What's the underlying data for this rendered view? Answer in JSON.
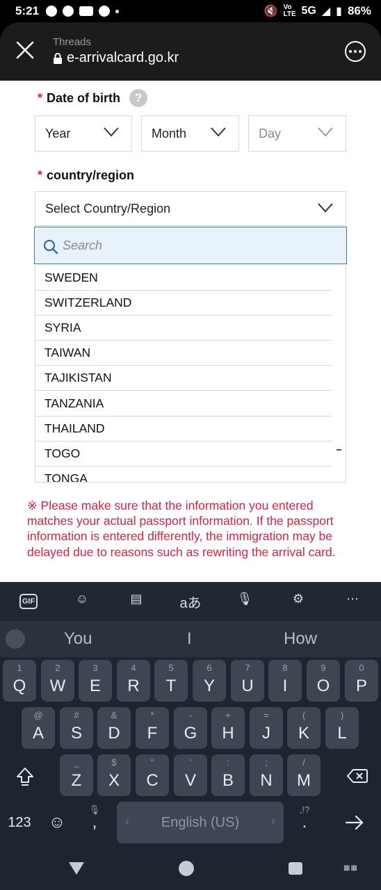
{
  "status_bar": {
    "time": "5:21",
    "network": "5G",
    "battery": "86%",
    "volte": "Vo LTE"
  },
  "browser": {
    "app_name": "Threads",
    "url": "e-arrivalcard.go.kr"
  },
  "form": {
    "required_mark": "*",
    "dob_label": "Date of birth",
    "help_glyph": "?",
    "year_label": "Year",
    "month_label": "Month",
    "day_label": "Day",
    "country_label": "country/region",
    "country_select": "Select Country/Region",
    "search_placeholder": "Search",
    "countries": [
      "SWEDEN",
      "SWITZERLAND",
      "SYRIA",
      "TAIWAN",
      "TAJIKISTAN",
      "TANZANIA",
      "THAILAND",
      "TOGO",
      "TONGA"
    ],
    "warning": "※ Please make sure that the information you entered matches your actual passport information. If the passport information is entered differently, the immigration may be delayed due to reasons such as rewriting the arrival card."
  },
  "keyboard": {
    "suggestions": [
      "You",
      "I",
      "How"
    ],
    "row1": [
      [
        "Q",
        "1"
      ],
      [
        "W",
        "2"
      ],
      [
        "E",
        "3"
      ],
      [
        "R",
        "4"
      ],
      [
        "T",
        "5"
      ],
      [
        "Y",
        "6"
      ],
      [
        "U",
        "7"
      ],
      [
        "I",
        "8"
      ],
      [
        "O",
        "9"
      ],
      [
        "P",
        "0"
      ]
    ],
    "row2": [
      [
        "A",
        "@"
      ],
      [
        "S",
        "#"
      ],
      [
        "D",
        "&"
      ],
      [
        "F",
        "*"
      ],
      [
        "G",
        "-"
      ],
      [
        "H",
        "+"
      ],
      [
        "J",
        "="
      ],
      [
        "K",
        "("
      ],
      [
        "L",
        ")"
      ]
    ],
    "row3": [
      [
        "Z",
        "_"
      ],
      [
        "X",
        "$"
      ],
      [
        "C",
        "\""
      ],
      [
        "V",
        "'"
      ],
      [
        "B",
        ":"
      ],
      [
        "N",
        ";"
      ],
      [
        "M",
        "/"
      ]
    ],
    "numbers_key": "123",
    "space_label": "English (US)",
    "comma": ",",
    "period": ".",
    "period_sec": ",!?",
    "gif_label": "GIF",
    "translate_label": "aあ"
  }
}
